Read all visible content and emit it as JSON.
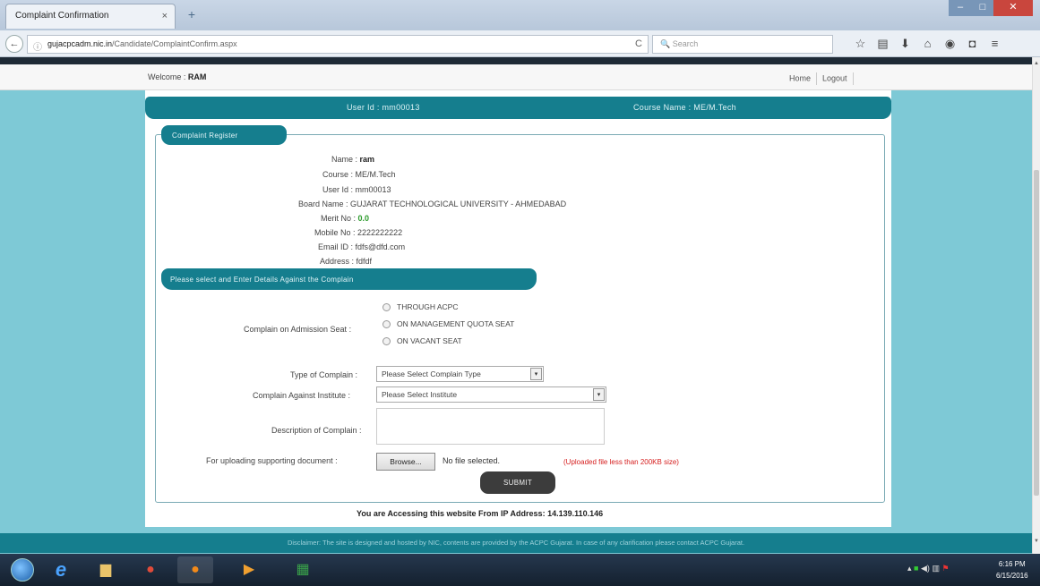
{
  "browser": {
    "tab_title": "Complaint Confirmation",
    "tab_close": "×",
    "new_tab": "+",
    "url_host": "gujacpcadm.nic.in",
    "url_path": "/Candidate/ComplaintConfirm.aspx",
    "search_placeholder": "Search",
    "reload": "C"
  },
  "header": {
    "welcome_label": "Welcome : ",
    "welcome_name": "RAM",
    "home": "Home",
    "logout": "Logout"
  },
  "info_bar": {
    "user_id": "User Id : mm00013",
    "course_name": "Course Name : ME/M.Tech"
  },
  "complaint_register": {
    "legend": "Complaint Register",
    "fields": [
      {
        "label": "Name : ",
        "value": "ram"
      },
      {
        "label": "Course : ",
        "value": "ME/M.Tech"
      },
      {
        "label": "User Id : ",
        "value": "mm00013"
      },
      {
        "label": "Board Name : ",
        "value": "GUJARAT TECHNOLOGICAL UNIVERSITY - AHMEDABAD"
      },
      {
        "label": "Merit No : ",
        "value": "0.0"
      },
      {
        "label": "Mobile No : ",
        "value": "2222222222"
      },
      {
        "label": "Email ID : ",
        "value": "fdfs@dfd.com"
      },
      {
        "label": "Address : ",
        "value": "fdfdf"
      }
    ]
  },
  "complaint_details": {
    "legend": "Please select and Enter Details Against the Complain",
    "admission_seat_label": "Complain on Admission Seat :",
    "admission_options": [
      "THROUGH ACPC",
      "ON MANAGEMENT QUOTA SEAT",
      "ON VACANT SEAT"
    ],
    "type_label": "Type of Complain :",
    "type_selected": "Please Select Complain Type",
    "institute_label": "Complain Against Institute :",
    "institute_selected": "Please Select Institute",
    "description_label": "Description of Complain :",
    "upload_label": "For uploading supporting document :",
    "browse_button": "Browse...",
    "no_file": "No file selected.",
    "upload_note": "(Uploaded file less than 200KB size)",
    "submit_button": "SUBMIT"
  },
  "ip_line": "You are Accessing this website From IP Address: 14.139.110.146",
  "disclaimer": "Disclaimer: The site is designed and hosted by NIC, contents are provided by the ACPC Gujarat. In case of any clarification please contact ACPC Gujarat.",
  "taskbar": {
    "time": "6:16 PM",
    "date": "6/15/2016"
  }
}
